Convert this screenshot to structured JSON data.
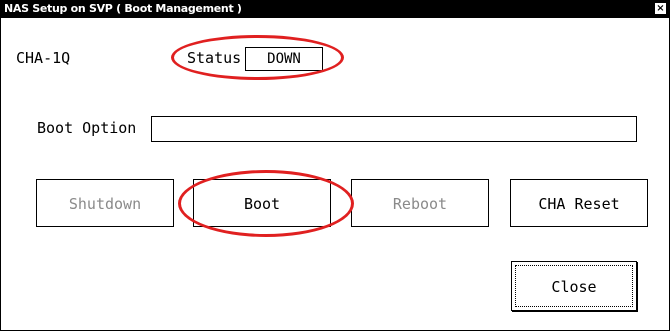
{
  "window": {
    "title": "NAS Setup on SVP ( Boot Management )",
    "close_glyph": "×"
  },
  "device": {
    "name": "CHA-1Q"
  },
  "status": {
    "label": "Status",
    "value": "DOWN"
  },
  "boot_option": {
    "label": "Boot Option",
    "value": ""
  },
  "buttons": {
    "shutdown": "Shutdown",
    "boot": "Boot",
    "reboot": "Reboot",
    "cha_reset": "CHA Reset",
    "close": "Close"
  },
  "colors": {
    "annotation": "#e02020",
    "disabled_text": "#8a8a8a"
  }
}
